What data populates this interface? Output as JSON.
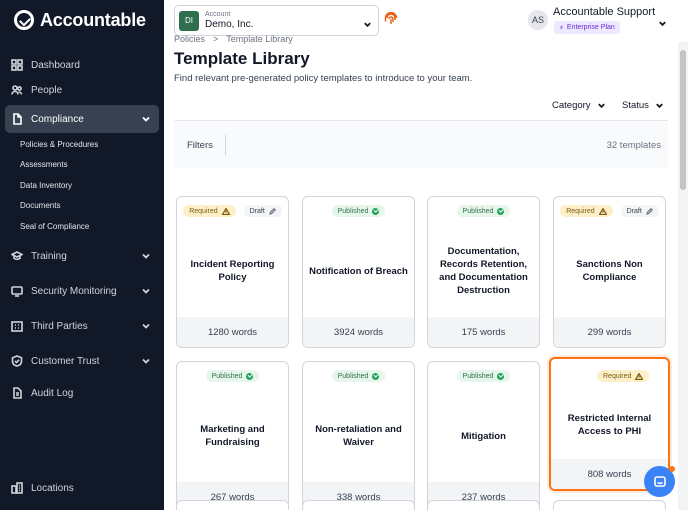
{
  "app": {
    "logo_text": "Accountable"
  },
  "account": {
    "initials": "DI",
    "label": "Account",
    "name": "Demo, Inc."
  },
  "user": {
    "initials": "AS",
    "name": "Accountable Support",
    "plan": "Enterprise Plan"
  },
  "sidebar": {
    "items": [
      {
        "label": "Dashboard",
        "icon": "grid-icon"
      },
      {
        "label": "People",
        "icon": "people-icon"
      },
      {
        "label": "Compliance",
        "icon": "document-icon",
        "active": true
      },
      {
        "label": "Training",
        "icon": "graduation-icon"
      },
      {
        "label": "Security Monitoring",
        "icon": "monitor-icon"
      },
      {
        "label": "Third Parties",
        "icon": "building-icon"
      },
      {
        "label": "Customer Trust",
        "icon": "shield-icon"
      },
      {
        "label": "Audit Log",
        "icon": "file-icon"
      },
      {
        "label": "Locations",
        "icon": "locations-icon"
      }
    ],
    "compliance_sub": [
      "Policies & Procedures",
      "Assessments",
      "Data Inventory",
      "Documents",
      "Seal of Compliance"
    ]
  },
  "breadcrumb": [
    "Policies",
    ">",
    "Template Library"
  ],
  "page": {
    "title": "Template Library",
    "subtitle": "Find relevant pre-generated policy templates to introduce to your team."
  },
  "filters": {
    "category_label": "Category",
    "status_label": "Status",
    "filters_label": "Filters",
    "count": "32 templates"
  },
  "cards": [
    {
      "title": "Incident Reporting Policy",
      "words": "1280 words",
      "badges": [
        {
          "type": "required",
          "label": "Required"
        },
        {
          "type": "draft",
          "label": "Draft"
        }
      ]
    },
    {
      "title": "Notification of Breach",
      "words": "3924 words",
      "badges": [
        {
          "type": "published",
          "label": "Published"
        }
      ]
    },
    {
      "title": "Documentation, Records Retention, and Documentation Destruction",
      "words": "175 words",
      "badges": [
        {
          "type": "published",
          "label": "Published"
        }
      ]
    },
    {
      "title": "Sanctions Non Compliance",
      "words": "299 words",
      "badges": [
        {
          "type": "required",
          "label": "Required"
        },
        {
          "type": "draft",
          "label": "Draft"
        }
      ]
    },
    {
      "title": "Marketing and Fundraising",
      "words": "267 words",
      "badges": [
        {
          "type": "published",
          "label": "Published"
        }
      ]
    },
    {
      "title": "Non-retaliation and Waiver",
      "words": "338 words",
      "badges": [
        {
          "type": "published",
          "label": "Published"
        }
      ]
    },
    {
      "title": "Mitigation",
      "words": "237 words",
      "badges": [
        {
          "type": "published",
          "label": "Published"
        }
      ]
    },
    {
      "title": "Restricted Internal Access to PHI",
      "words": "808 words",
      "badges": [
        {
          "type": "required",
          "label": "Required"
        }
      ],
      "selected": true
    }
  ],
  "colors": {
    "sidebar_bg": "#111827",
    "accent_selected": "#f97316",
    "published_green": "#22a35a",
    "required_bg": "#fdf0c9"
  }
}
